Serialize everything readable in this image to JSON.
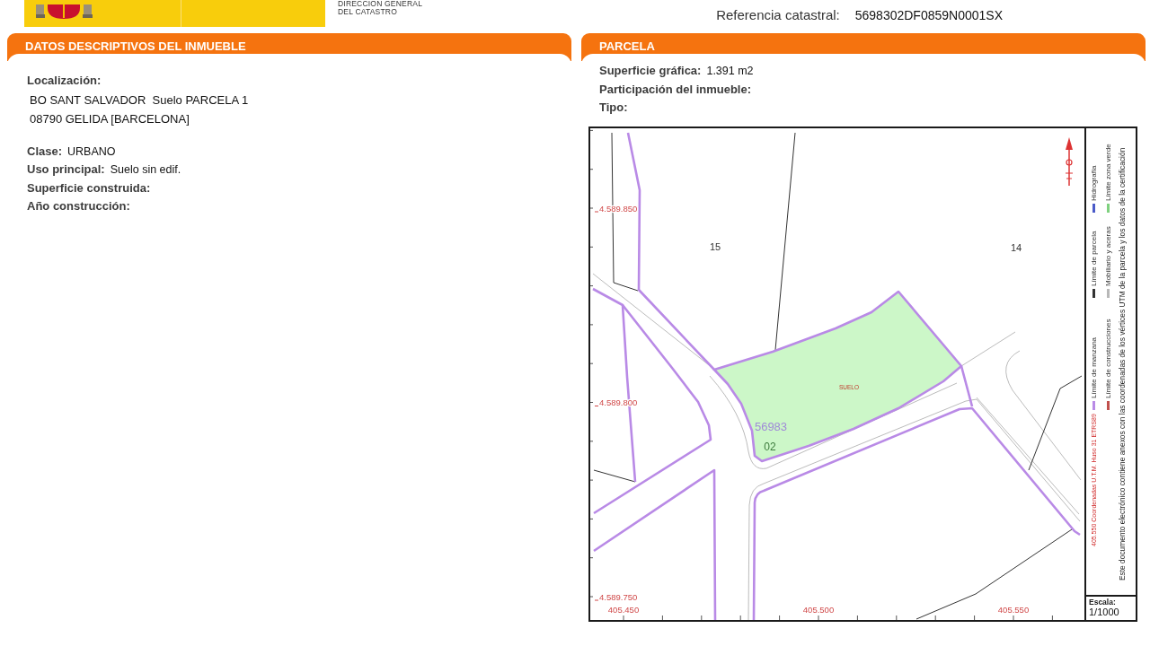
{
  "header": {
    "agency_lines": [
      "DIRECCIÓN GENERAL",
      "DEL CATASTRO"
    ],
    "reference": {
      "label": "Referencia catastral:",
      "value": "5698302DF0859N0001SX"
    }
  },
  "descriptive_panel": {
    "title": "DATOS DESCRIPTIVOS DEL INMUEBLE",
    "location": {
      "label": "Localización:",
      "lines": [
        "BO SANT SALVADOR  Suelo PARCELA 1",
        "08790 GELIDA [BARCELONA]"
      ]
    },
    "fields": [
      {
        "label": "Clase:",
        "value": "URBANO"
      },
      {
        "label": "Uso principal:",
        "value": "Suelo sin edif."
      },
      {
        "label": "Superficie construida:"
      },
      {
        "label": "Año construcción:"
      }
    ]
  },
  "parcel_panel": {
    "title": "PARCELA",
    "fields": [
      {
        "label": "Superficie gráfica:",
        "value": "1.391 m2"
      },
      {
        "label": "Participación del inmueble:"
      },
      {
        "label": "Tipo:"
      }
    ],
    "map": {
      "labels": [
        {
          "kind": "parcel_number",
          "text": "15"
        },
        {
          "kind": "parcel_number",
          "text": "14"
        },
        {
          "kind": "land_use",
          "text": "SUELO"
        },
        {
          "kind": "block_number",
          "text": "56983"
        },
        {
          "kind": "subparcel_number",
          "text": "02"
        }
      ],
      "northing_labels": [
        "4.589.850",
        "4.589.800",
        "4.589.750"
      ],
      "easting_labels": [
        "405.450",
        "405.500",
        "405.550"
      ],
      "legend_columns": [
        {
          "caption": "405.550 Coordenadas U.T.M. Huso 31 ETRS89",
          "entries": [
            {
              "label": "Límite de manzana",
              "color": "#b98ae6"
            },
            {
              "label": "Límite de parcela",
              "color": "#333333"
            },
            {
              "label": "Hidrografía",
              "color": "#4a5ac8"
            }
          ]
        },
        {
          "entries": [
            {
              "label": "Límite de construcciones",
              "color": "#c0504d"
            },
            {
              "label": "Mobiliario y aceras",
              "color": "#b8b8b8"
            },
            {
              "label": "Límite zona verde",
              "color": "#7fd17f"
            }
          ]
        }
      ],
      "note": "Este documento electrónico contiene anexos con las coordenadas de los vértices UTM de la parcela y los datos de la certificación",
      "scale": {
        "label": "Escala:",
        "value": "1/1000"
      }
    }
  }
}
